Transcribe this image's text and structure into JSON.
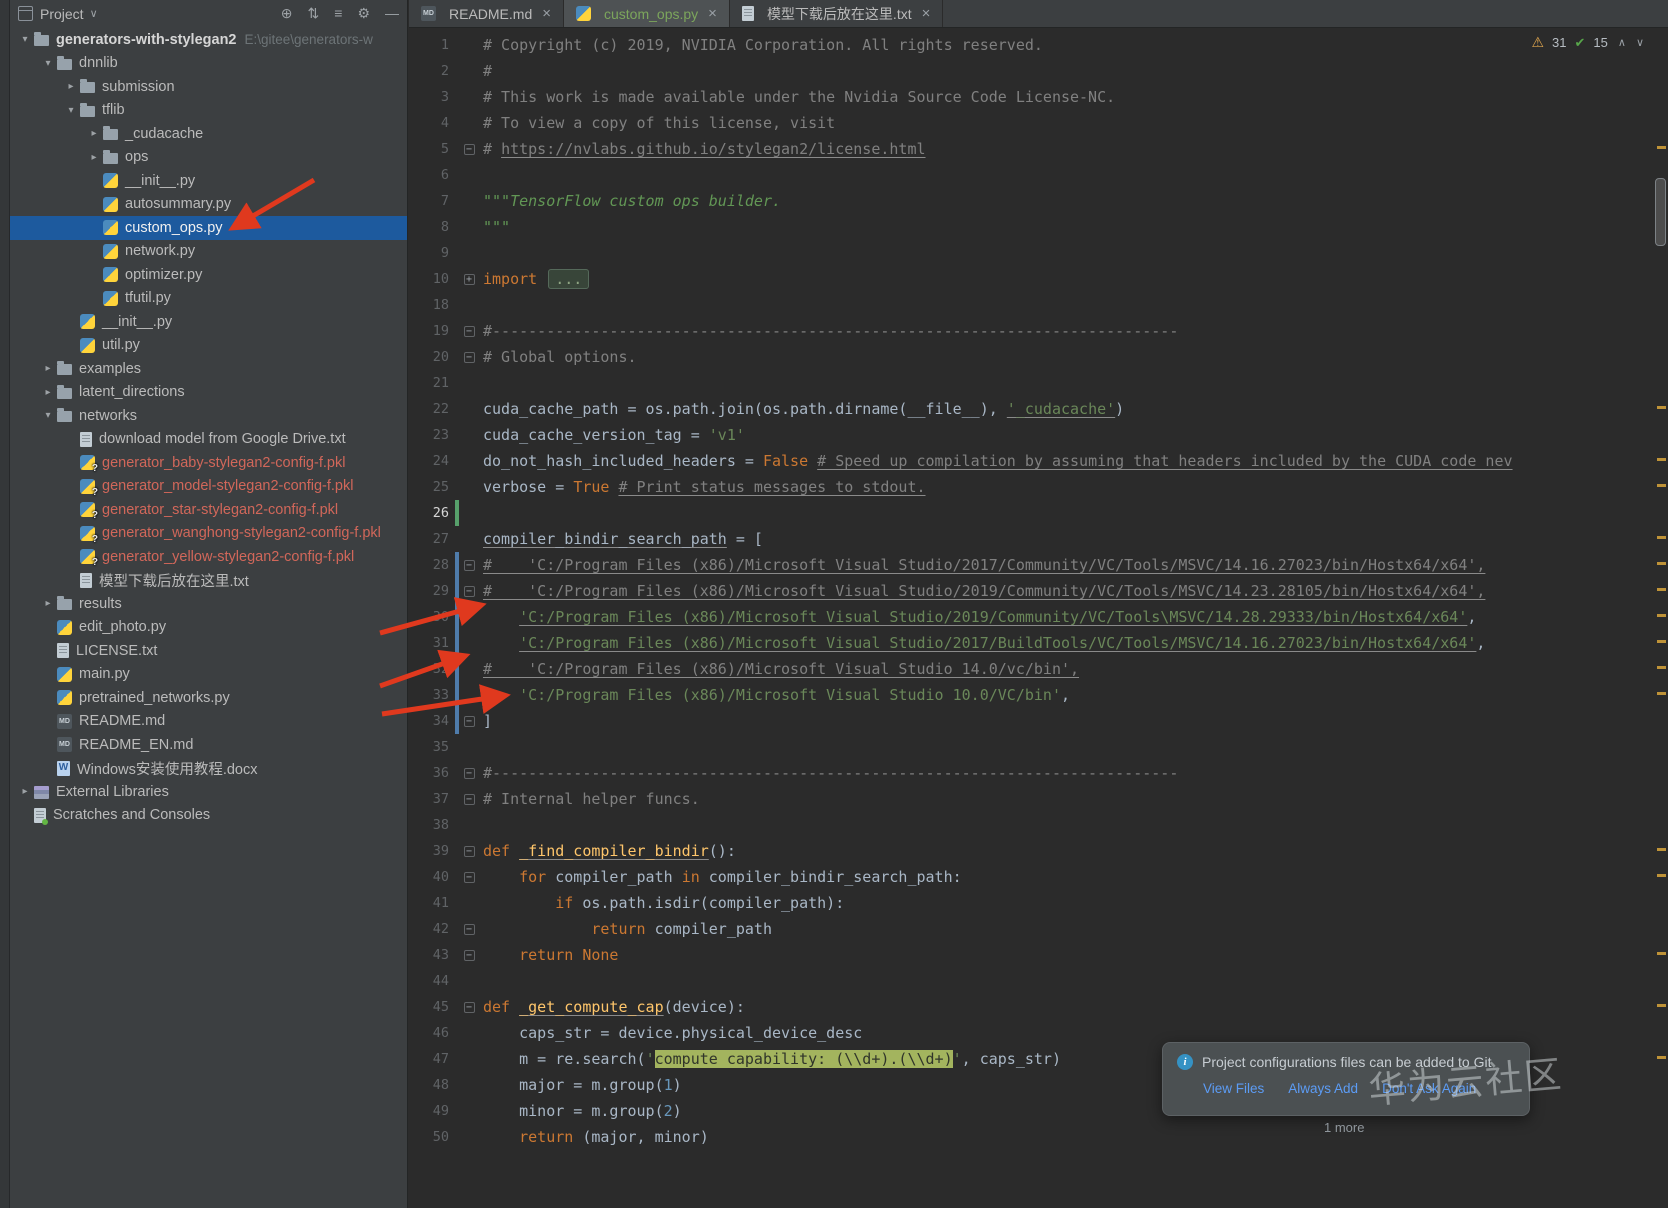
{
  "project_panel": {
    "title": "Project",
    "dropdown_chevron": "∨",
    "header_icons": [
      {
        "glyph": "⊕",
        "name": "locate-file-button"
      },
      {
        "glyph": "⇅",
        "name": "expand-all-button"
      },
      {
        "glyph": "≡",
        "name": "collapse-all-button"
      },
      {
        "glyph": "⚙",
        "name": "settings-button"
      },
      {
        "glyph": "—",
        "name": "hide-panel-button"
      }
    ],
    "tree": [
      {
        "label": "generators-with-stylegan2",
        "suffix": "E:\\gitee\\generators-w",
        "type": "folder",
        "indent": 0,
        "chevron": "open",
        "bold": true
      },
      {
        "label": "dnnlib",
        "type": "folder",
        "indent": 1,
        "chevron": "open"
      },
      {
        "label": "submission",
        "type": "folder",
        "indent": 2,
        "chevron": "closed"
      },
      {
        "label": "tflib",
        "type": "folder",
        "indent": 2,
        "chevron": "open"
      },
      {
        "label": "_cudacache",
        "type": "folder",
        "indent": 3,
        "chevron": "closed"
      },
      {
        "label": "ops",
        "type": "folder",
        "indent": 3,
        "chevron": "closed"
      },
      {
        "label": "__init__.py",
        "type": "py",
        "indent": 3
      },
      {
        "label": "autosummary.py",
        "type": "py",
        "indent": 3
      },
      {
        "label": "custom_ops.py",
        "type": "py",
        "indent": 3,
        "selected": true
      },
      {
        "label": "network.py",
        "type": "py",
        "indent": 3
      },
      {
        "label": "optimizer.py",
        "type": "py",
        "indent": 3
      },
      {
        "label": "tfutil.py",
        "type": "py",
        "indent": 3
      },
      {
        "label": "__init__.py",
        "type": "py",
        "indent": 2
      },
      {
        "label": "util.py",
        "type": "py",
        "indent": 2
      },
      {
        "label": "examples",
        "type": "folder",
        "indent": 1,
        "chevron": "closed"
      },
      {
        "label": "latent_directions",
        "type": "folder",
        "indent": 1,
        "chevron": "closed"
      },
      {
        "label": "networks",
        "type": "folder",
        "indent": 1,
        "chevron": "open"
      },
      {
        "label": "download model from Google Drive.txt",
        "type": "txt",
        "indent": 2
      },
      {
        "label": "generator_baby-stylegan2-config-f.pkl",
        "type": "pkl",
        "indent": 2,
        "vcs": "red"
      },
      {
        "label": "generator_model-stylegan2-config-f.pkl",
        "type": "pkl",
        "indent": 2,
        "vcs": "red"
      },
      {
        "label": "generator_star-stylegan2-config-f.pkl",
        "type": "pkl",
        "indent": 2,
        "vcs": "red"
      },
      {
        "label": "generator_wanghong-stylegan2-config-f.pkl",
        "type": "pkl",
        "indent": 2,
        "vcs": "red"
      },
      {
        "label": "generator_yellow-stylegan2-config-f.pkl",
        "type": "pkl",
        "indent": 2,
        "vcs": "red"
      },
      {
        "label": "模型下载后放在这里.txt",
        "type": "txt",
        "indent": 2
      },
      {
        "label": "results",
        "type": "folder",
        "indent": 1,
        "chevron": "closed"
      },
      {
        "label": "edit_photo.py",
        "type": "py",
        "indent": 1
      },
      {
        "label": "LICENSE.txt",
        "type": "txt",
        "indent": 1
      },
      {
        "label": "main.py",
        "type": "py",
        "indent": 1
      },
      {
        "label": "pretrained_networks.py",
        "type": "py",
        "indent": 1
      },
      {
        "label": "README.md",
        "type": "md",
        "indent": 1
      },
      {
        "label": "README_EN.md",
        "type": "md",
        "indent": 1
      },
      {
        "label": "Windows安装使用教程.docx",
        "type": "docx",
        "indent": 1
      },
      {
        "label": "External Libraries",
        "type": "lib",
        "indent": 0,
        "chevron": "closed"
      },
      {
        "label": "Scratches and Consoles",
        "type": "scratch",
        "indent": 0
      }
    ]
  },
  "tabs": [
    {
      "label": "README.md",
      "icon": "md",
      "active": false,
      "color": "#bbbbbb"
    },
    {
      "label": "custom_ops.py",
      "icon": "py",
      "active": true,
      "color": "#7ca65c"
    },
    {
      "label": "模型下载后放在这里.txt",
      "icon": "txt",
      "active": false,
      "color": "#bbbbbb"
    }
  ],
  "editor": {
    "inspections": {
      "warnings": "31",
      "passed": "15",
      "prev": "∧",
      "next": "∨"
    },
    "stripe_marks": [
      118,
      378,
      430,
      456,
      508,
      534,
      560,
      586,
      612,
      638,
      664,
      820,
      846,
      924,
      976,
      1028
    ],
    "lines": [
      {
        "n": 1,
        "tok": [
          [
            "c",
            "# Copyright (c) 2019, NVIDIA Corporation. All rights reserved."
          ]
        ]
      },
      {
        "n": 2,
        "tok": [
          [
            "c",
            "#"
          ]
        ]
      },
      {
        "n": 3,
        "tok": [
          [
            "c",
            "# This work is made available under the Nvidia Source Code License-NC."
          ]
        ]
      },
      {
        "n": 4,
        "tok": [
          [
            "c",
            "# To view a copy of this license, visit"
          ]
        ]
      },
      {
        "n": 5,
        "fold": "minus",
        "tok": [
          [
            "c",
            "# "
          ],
          [
            "cu",
            "https://nvlabs.github.io/stylegan2/license.html"
          ]
        ]
      },
      {
        "n": 6,
        "tok": []
      },
      {
        "n": 7,
        "tok": [
          [
            "d",
            "\"\"\"TensorFlow custom ops builder."
          ]
        ]
      },
      {
        "n": 8,
        "tok": [
          [
            "d",
            "\"\"\""
          ]
        ]
      },
      {
        "n": 9,
        "tok": []
      },
      {
        "n": 10,
        "fold": "plus",
        "tok": [
          [
            "k",
            "import"
          ],
          [
            "t",
            " "
          ],
          [
            "fb",
            "..."
          ]
        ]
      },
      {
        "n": 18,
        "tok": []
      },
      {
        "n": 19,
        "fold": "minus",
        "tok": [
          [
            "c",
            "#----------------------------------------------------------------------------"
          ]
        ]
      },
      {
        "n": 20,
        "fold": "minus",
        "tok": [
          [
            "c",
            "# Global options."
          ]
        ]
      },
      {
        "n": 21,
        "tok": []
      },
      {
        "n": 22,
        "tok": [
          [
            "t",
            "cuda_cache_path = os.path.join(os.path.dirname(__file__), "
          ],
          [
            "su",
            "'_cudacache'"
          ],
          [
            "t",
            ")"
          ]
        ]
      },
      {
        "n": 23,
        "tok": [
          [
            "t",
            "cuda_cache_version_tag = "
          ],
          [
            "s",
            "'v1'"
          ]
        ]
      },
      {
        "n": 24,
        "tok": [
          [
            "t",
            "do_not_hash_included_headers = "
          ],
          [
            "k",
            "False"
          ],
          [
            "t",
            " "
          ],
          [
            "cu",
            "# Speed up compilation by assuming that headers included by the CUDA code nev"
          ]
        ]
      },
      {
        "n": 25,
        "tok": [
          [
            "t",
            "verbose = "
          ],
          [
            "k",
            "True"
          ],
          [
            "t",
            " "
          ],
          [
            "cu",
            "# Print status messages to stdout."
          ]
        ]
      },
      {
        "n": 26,
        "caret": true,
        "chg": "green",
        "tok": []
      },
      {
        "n": 27,
        "tok": [
          [
            "tu",
            "compiler_bindir_search_path"
          ],
          [
            "t",
            " = ["
          ]
        ]
      },
      {
        "n": 28,
        "fold": "minus",
        "chg": "blue",
        "tok": [
          [
            "cu",
            "#    'C:/Program Files (x86)/Microsoft Visual Studio/2017/Community/VC/Tools/MSVC/14.16.27023/bin/Hostx64/x64',"
          ]
        ]
      },
      {
        "n": 29,
        "fold": "minus",
        "chg": "blue",
        "tok": [
          [
            "cu",
            "#    'C:/Program Files (x86)/Microsoft Visual Studio/2019/Community/VC/Tools/MSVC/14.23.28105/bin/Hostx64/x64',"
          ]
        ]
      },
      {
        "n": 30,
        "chg": "blue",
        "tok": [
          [
            "t",
            "    "
          ],
          [
            "su",
            "'C:/Program Files (x86)/Microsoft Visual Studio/2019/Community/VC/Tools\\MSVC/14.28.29333/bin/Hostx64/x64'"
          ],
          [
            "t",
            ","
          ]
        ]
      },
      {
        "n": 31,
        "chg": "blue",
        "tok": [
          [
            "t",
            "    "
          ],
          [
            "su",
            "'C:/Program Files (x86)/Microsoft Visual Studio/2017/BuildTools/VC/Tools/MSVC/14.16.27023/bin/Hostx64/x64'"
          ],
          [
            "t",
            ","
          ]
        ]
      },
      {
        "n": 32,
        "chg": "blue",
        "tok": [
          [
            "cu",
            "#    'C:/Program Files (x86)/Microsoft Visual Studio 14.0/vc/bin',"
          ]
        ]
      },
      {
        "n": 33,
        "chg": "blue",
        "tok": [
          [
            "t",
            "    "
          ],
          [
            "s",
            "'C:/Program Files (x86)/Microsoft Visual Studio 10.0/VC/bin'"
          ],
          [
            "t",
            ","
          ]
        ]
      },
      {
        "n": 34,
        "fold": "minus",
        "chg": "blue",
        "tok": [
          [
            "t",
            "]"
          ]
        ]
      },
      {
        "n": 35,
        "tok": []
      },
      {
        "n": 36,
        "fold": "minus",
        "tok": [
          [
            "c",
            "#----------------------------------------------------------------------------"
          ]
        ]
      },
      {
        "n": 37,
        "fold": "minus",
        "tok": [
          [
            "c",
            "# Internal helper funcs."
          ]
        ]
      },
      {
        "n": 38,
        "tok": []
      },
      {
        "n": 39,
        "fold": "minus",
        "tok": [
          [
            "k",
            "def"
          ],
          [
            "t",
            " "
          ],
          [
            "fu",
            "_find_compiler_bindir"
          ],
          [
            "t",
            "():"
          ]
        ]
      },
      {
        "n": 40,
        "fold": "minus",
        "tok": [
          [
            "t",
            "    "
          ],
          [
            "k",
            "for"
          ],
          [
            "t",
            " compiler_path "
          ],
          [
            "k",
            "in"
          ],
          [
            "t",
            " compiler_bindir_search_path:"
          ]
        ]
      },
      {
        "n": 41,
        "tok": [
          [
            "t",
            "        "
          ],
          [
            "k",
            "if"
          ],
          [
            "t",
            " os.path.isdir(compiler_path):"
          ]
        ]
      },
      {
        "n": 42,
        "fold": "minus",
        "tok": [
          [
            "t",
            "            "
          ],
          [
            "k",
            "return"
          ],
          [
            "t",
            " compiler_path"
          ]
        ]
      },
      {
        "n": 43,
        "fold": "minus",
        "tok": [
          [
            "t",
            "    "
          ],
          [
            "k",
            "return"
          ],
          [
            "t",
            " "
          ],
          [
            "k",
            "None"
          ]
        ]
      },
      {
        "n": 44,
        "tok": []
      },
      {
        "n": 45,
        "fold": "minus",
        "tok": [
          [
            "k",
            "def"
          ],
          [
            "t",
            " "
          ],
          [
            "fu",
            "_get_compute_cap"
          ],
          [
            "t",
            "(device):"
          ]
        ]
      },
      {
        "n": 46,
        "tok": [
          [
            "t",
            "    caps_str = device.physical_device_desc"
          ]
        ]
      },
      {
        "n": 47,
        "tok": [
          [
            "t",
            "    m = re.search("
          ],
          [
            "s",
            "'"
          ],
          [
            "inj",
            "compute capability: (\\\\d+).(\\\\d+)"
          ],
          [
            "s",
            "'"
          ],
          [
            "t",
            ", caps_str)"
          ]
        ]
      },
      {
        "n": 48,
        "tok": [
          [
            "t",
            "    major = m.group("
          ],
          [
            "n2",
            "1"
          ],
          [
            "t",
            ")"
          ]
        ]
      },
      {
        "n": 49,
        "tok": [
          [
            "t",
            "    minor = m.group("
          ],
          [
            "n2",
            "2"
          ],
          [
            "t",
            ")"
          ]
        ]
      },
      {
        "n": 50,
        "tok": [
          [
            "t",
            "    "
          ],
          [
            "k",
            "return"
          ],
          [
            "t",
            " (major, minor)"
          ]
        ]
      }
    ]
  },
  "notification": {
    "message": "Project configurations files can be added to Git",
    "actions": [
      "View Files",
      "Always Add",
      "Don't Ask Again"
    ],
    "more": "1 more"
  },
  "watermark": "华为云社区"
}
